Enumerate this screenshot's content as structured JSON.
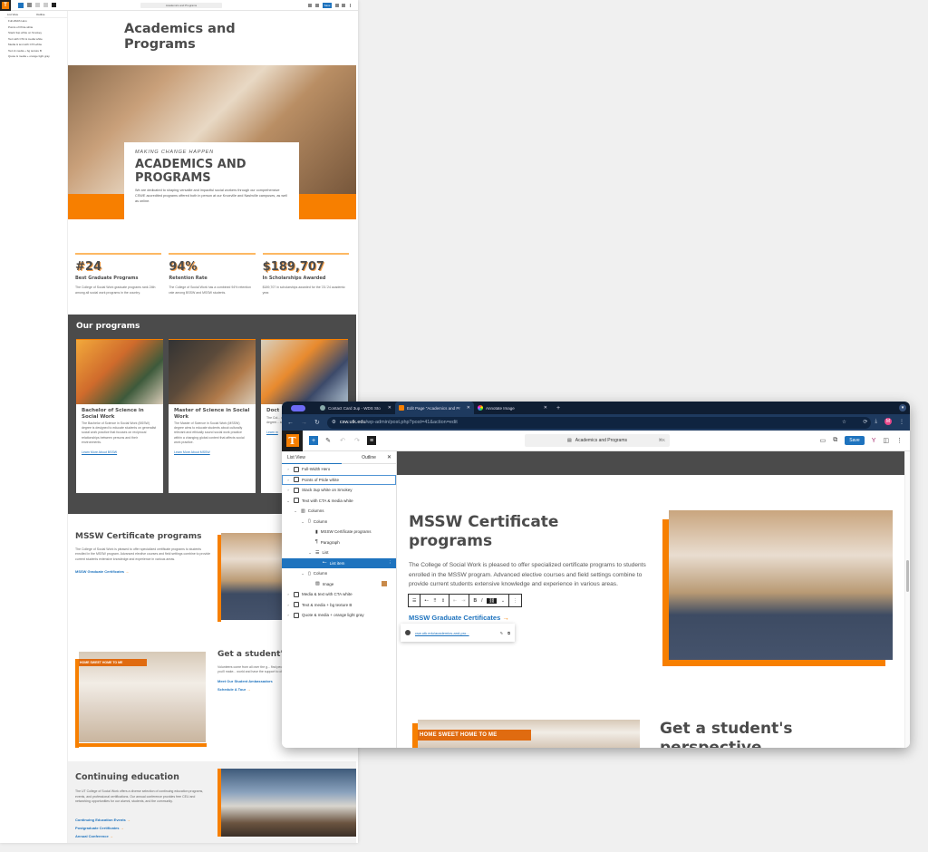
{
  "background_editor": {
    "doc_title": "Academics and Programs",
    "save_label": "Save",
    "list_view": {
      "tabs": [
        "List View",
        "Outline"
      ],
      "items": [
        "Full-Width Hero",
        "Points of Pride white",
        "Stack 3up white on Smokey",
        "Text with CTA & media white",
        "Media & text with CTA white",
        "Text & media + bg texture B",
        "Quote & media + orange light gray"
      ]
    },
    "page": {
      "title": "Academics and Programs",
      "hero": {
        "kicker": "MAKING CHANGE HAPPEN",
        "heading": "ACADEMICS AND PROGRAMS",
        "body": "We are dedicated to shaping versatile and impactful social workers through our comprehensive CSWE accredited programs offered both in person at our Knoxville and Nashville campuses, as well as online."
      },
      "stats": [
        {
          "value": "#24",
          "label": "Best Graduate Programs",
          "body": "The College of Social Work graduate programs rank 24th among all social work programs in the country."
        },
        {
          "value": "94%",
          "label": "Retention Rate",
          "body": "The College of Social Work has a combined 94% retention rate among BSSW and MSSW students."
        },
        {
          "value": "$189,707",
          "label": "In Scholarships Awarded",
          "body": "$189,707 in scholarships awarded for the '23-'24 academic year."
        }
      ],
      "programs": {
        "heading": "Our programs",
        "cards": [
          {
            "title": "Bachelor of Science in Social Work",
            "body": "The Bachelor of Science in Social Work (BSSW) degree is designed to educate students on generalist social work practice that focuses on reciprocal relationships between persons and their environments.",
            "link": "Learn More About BSSW"
          },
          {
            "title": "Master of Science in Social Work",
            "body": "The Master of Science in Social Work (MSSW) degree aims to educate students about culturally relevant and ethically sound social work practice within a changing global context that affects social work practice.",
            "link": "Learn More About MSSW"
          },
          {
            "title": "Doct",
            "body": "The Col... doctora... accele... profess... clinical... degree... academ... program... advanc...",
            "link": "Learn m"
          }
        ]
      },
      "mssw": {
        "heading": "MSSW Certificate programs",
        "body": "The College of Social Work is pleased to offer specialized certificate programs to students enrolled in the MSSW program. Advanced elective courses and field settings combine to provide current students extensive knowledge and experience in various areas.",
        "link": "MSSW Graduate Certificates"
      },
      "student": {
        "heading": "Get a student's perspective",
        "banner": "HOME SWEET HOME TO ME",
        "body": "Volunteers come from all over the g... find people who understand your g... College of Social Work, you'll make... world and have the support to cha... quickly become home, sweet home.",
        "links": [
          "Meet Our Student Ambassadors",
          "Schedule A Tour"
        ]
      },
      "continuing": {
        "heading": "Continuing education",
        "body": "The UT College of Social Work offers a diverse selection of continuing education programs, events, and professional certifications. Our annual conference provides free CEU and networking opportunities for our alumni, students, and the community.",
        "links": [
          "Continuing Education Events",
          "Postgraduate Certificates",
          "Annual Conference"
        ]
      }
    }
  },
  "browser": {
    "tabs": [
      {
        "label": "Contact Card 3up - WDS Sto",
        "active": false
      },
      {
        "label": "Edit Page \"Academics and Pr",
        "active": true
      },
      {
        "label": "Annotate Image",
        "active": false
      }
    ],
    "url_host": "csw.utk.edu",
    "url_path": "/wp-admin/post.php?post=41&action=edit",
    "avatar_initial": "M"
  },
  "editor": {
    "logo_letter": "T",
    "doc_title": "Academics and Programs",
    "shortcut": "⌘K",
    "save_label": "Save",
    "list_view": {
      "tabs": [
        "List View",
        "Outline"
      ],
      "items": [
        {
          "label": "Full-Width Hero",
          "depth": 0,
          "expanded": false
        },
        {
          "label": "Points of Pride white",
          "depth": 0,
          "expanded": false,
          "focused": true
        },
        {
          "label": "Stack 3up white on Smokey",
          "depth": 0,
          "expanded": false
        },
        {
          "label": "Text with CTA & media white",
          "depth": 0,
          "expanded": true
        },
        {
          "label": "Columns",
          "depth": 1,
          "expanded": true
        },
        {
          "label": "Column",
          "depth": 2,
          "expanded": true
        },
        {
          "label": "MSSW Certificate programs",
          "depth": 3
        },
        {
          "label": "Paragraph",
          "depth": 3
        },
        {
          "label": "List",
          "depth": 3,
          "expanded": true
        },
        {
          "label": "List item",
          "depth": 4,
          "selected": true
        },
        {
          "label": "Column",
          "depth": 2,
          "expanded": true
        },
        {
          "label": "Image",
          "depth": 3
        },
        {
          "label": "Media & text with CTA white",
          "depth": 0,
          "expanded": false
        },
        {
          "label": "Text & media + bg texture B",
          "depth": 0,
          "expanded": false
        },
        {
          "label": "Quote & media + orange light gray",
          "depth": 0,
          "expanded": false
        }
      ]
    },
    "content": {
      "heading": "MSSW Certificate programs",
      "body": "The College of Social Work is pleased to offer specialized certificate programs to students enrolled in the MSSW program. Advanced elective courses and field settings combine to provide current students extensive knowledge and experience in various areas.",
      "link": "MSSW Graduate Certificates",
      "link_url": "csw.utk.edu/academics-and-pro...",
      "next_heading": "Get a student's perspective",
      "banner": "HOME SWEET HOME TO ME"
    },
    "toolbar": {
      "bold": "B",
      "italic": "I"
    }
  },
  "colors": {
    "accent_orange": "#f77f00",
    "link_blue": "#1e73be",
    "heading_gray": "#4b4b4b",
    "browser_dark": "#0f1e33"
  }
}
